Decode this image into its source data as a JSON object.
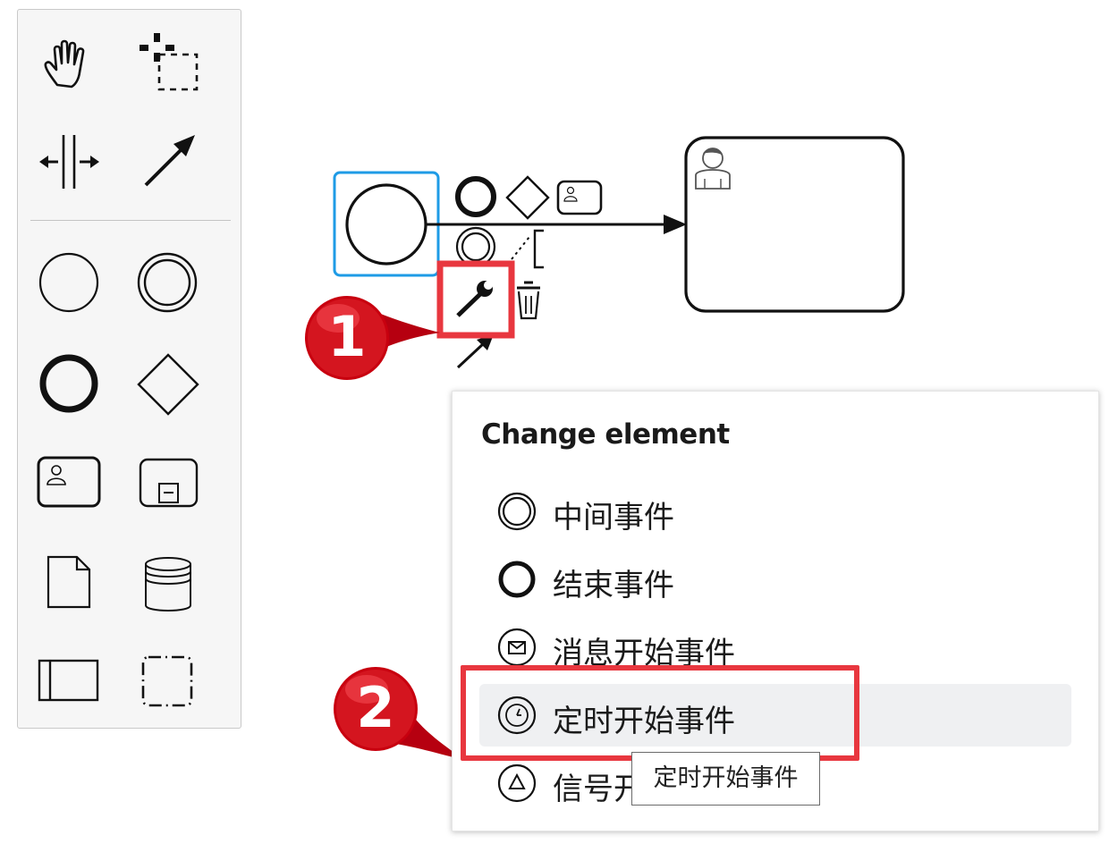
{
  "palette": {
    "tools": [
      {
        "name": "hand-tool-icon",
        "label": "hand tool"
      },
      {
        "name": "lasso-tool-icon",
        "label": "lasso tool"
      },
      {
        "name": "space-tool-icon",
        "label": "space tool"
      },
      {
        "name": "global-connect-tool-icon",
        "label": "connect tool"
      },
      {
        "name": "start-event-icon",
        "label": "start event"
      },
      {
        "name": "intermediate-event-icon",
        "label": "intermediate event"
      },
      {
        "name": "end-event-icon",
        "label": "end event"
      },
      {
        "name": "gateway-icon",
        "label": "gateway"
      },
      {
        "name": "user-task-icon",
        "label": "user task"
      },
      {
        "name": "subprocess-icon",
        "label": "subprocess"
      },
      {
        "name": "data-object-icon",
        "label": "data object"
      },
      {
        "name": "data-store-icon",
        "label": "data store"
      },
      {
        "name": "pool-icon",
        "label": "pool"
      },
      {
        "name": "group-icon",
        "label": "group"
      }
    ]
  },
  "canvas": {
    "selection_color": "#1e9be6",
    "stroke_color": "#111111"
  },
  "context_pad": {
    "items": [
      "end-event-icon",
      "gateway-icon",
      "user-task-icon",
      "intermediate-event-icon",
      "text-annotation-icon",
      "wrench-icon",
      "trash-icon",
      "connect-arrow-icon"
    ]
  },
  "annotations": {
    "accent": "#e8373f",
    "badge1": "1",
    "badge2": "2"
  },
  "popup": {
    "title": "Change element",
    "entries": [
      {
        "label": "中间事件",
        "icon": "intermediate-event-icon"
      },
      {
        "label": "结束事件",
        "icon": "end-event-icon"
      },
      {
        "label": "消息开始事件",
        "icon": "message-start-event-icon"
      },
      {
        "label": "定时开始事件",
        "icon": "timer-start-event-icon",
        "hovered": true
      },
      {
        "label": "信号开",
        "icon": "signal-start-event-icon"
      }
    ],
    "tooltip": "定时开始事件"
  }
}
